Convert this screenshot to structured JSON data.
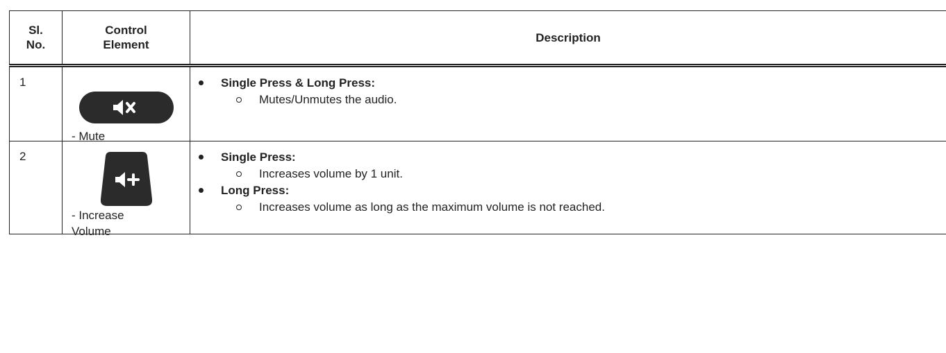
{
  "table": {
    "headers": [
      "Sl. No.",
      "Control Element",
      "Description"
    ],
    "header_lines": {
      "col1": [
        "Sl.",
        "No."
      ],
      "col2": [
        "Control",
        "Element"
      ],
      "col3": "Description"
    },
    "rows": [
      {
        "number": "1",
        "control_icon": "mute-button-icon",
        "control_label_lines": [
          "- Mute"
        ],
        "items": [
          {
            "title": "Single Press & Long Press:",
            "details": [
              "Mutes/Unmutes the audio."
            ]
          }
        ]
      },
      {
        "number": "2",
        "control_icon": "volume-up-button-icon",
        "control_label_lines": [
          "- Increase",
          "Volume"
        ],
        "items": [
          {
            "title": "Single Press:",
            "details": [
              "Increases volume by 1 unit."
            ]
          },
          {
            "title": "Long Press:",
            "details": [
              "Increases volume as long as the maximum volume is not reached."
            ]
          }
        ]
      }
    ]
  },
  "colors": {
    "text": "#222222",
    "button_fill": "#2b2b2b",
    "button_symbol": "#ffffff"
  }
}
